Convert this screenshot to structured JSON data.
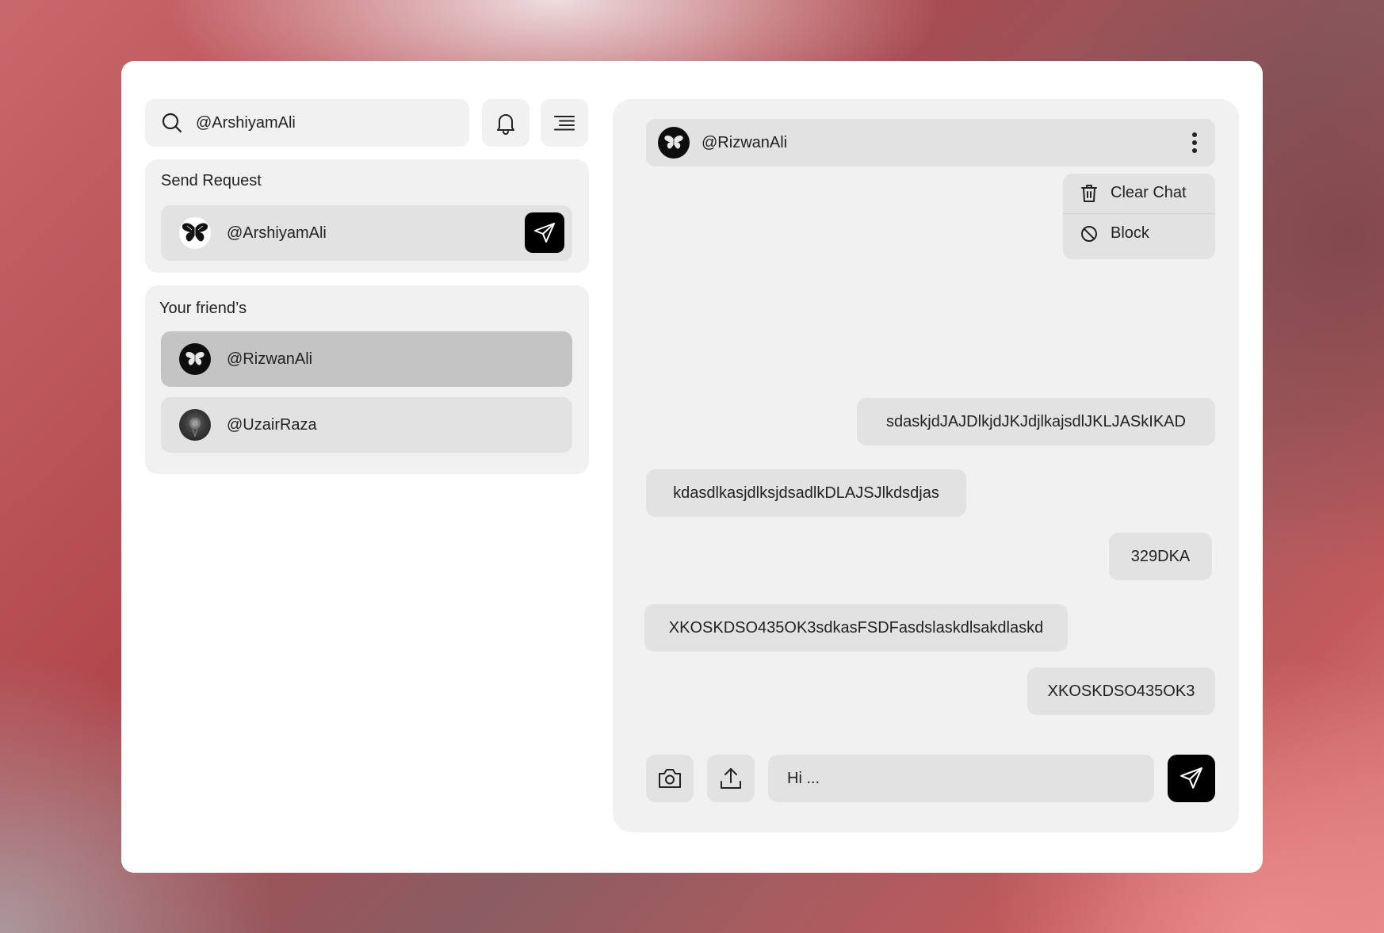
{
  "search": {
    "value": "@ArshiyamAli",
    "icon": "search-icon"
  },
  "toolbar": {
    "notifications_icon": "bell-icon",
    "menu_icon": "menu-lines-icon"
  },
  "send_request": {
    "title": "Send Request",
    "user": {
      "name": "@ArshiyamAli",
      "avatar": "butterfly-avatar"
    },
    "action_icon": "send-icon"
  },
  "friends": {
    "title": "Your friend’s",
    "items": [
      {
        "name": "@RizwanAli",
        "avatar": "butterfly-avatar",
        "active": true
      },
      {
        "name": "@UzairRaza",
        "avatar": "photo-avatar",
        "active": false
      }
    ]
  },
  "chat": {
    "header": {
      "name": "@RizwanAli",
      "more_icon": "kebab-icon"
    },
    "menu": [
      {
        "label": "Clear Chat",
        "icon": "trash-icon"
      },
      {
        "label": "Block",
        "icon": "block-icon"
      }
    ],
    "messages": [
      {
        "text": "sdaskjdJAJDlkjdJKJdjlkajsdlJKLJASkIKAD",
        "side": "sent"
      },
      {
        "text": "kdasdlkasjdlksjdsadlkDLAJSJlkdsdjas",
        "side": "received"
      },
      {
        "text": "329DKA",
        "side": "sent"
      },
      {
        "text": "XKOSKDSO435OK3sdkasFSDFasdslaskdlsakdlaskd",
        "side": "received"
      },
      {
        "text": "XKOSKDSO435OK3",
        "side": "sent"
      }
    ],
    "composer": {
      "value": "Hi ...",
      "camera_icon": "camera-icon",
      "upload_icon": "upload-icon",
      "send_icon": "send-icon"
    }
  },
  "colors": {
    "panel": "#f1f1f1",
    "item": "#e2e2e2",
    "active_item": "#c4c4c4",
    "accent": "#000000"
  }
}
